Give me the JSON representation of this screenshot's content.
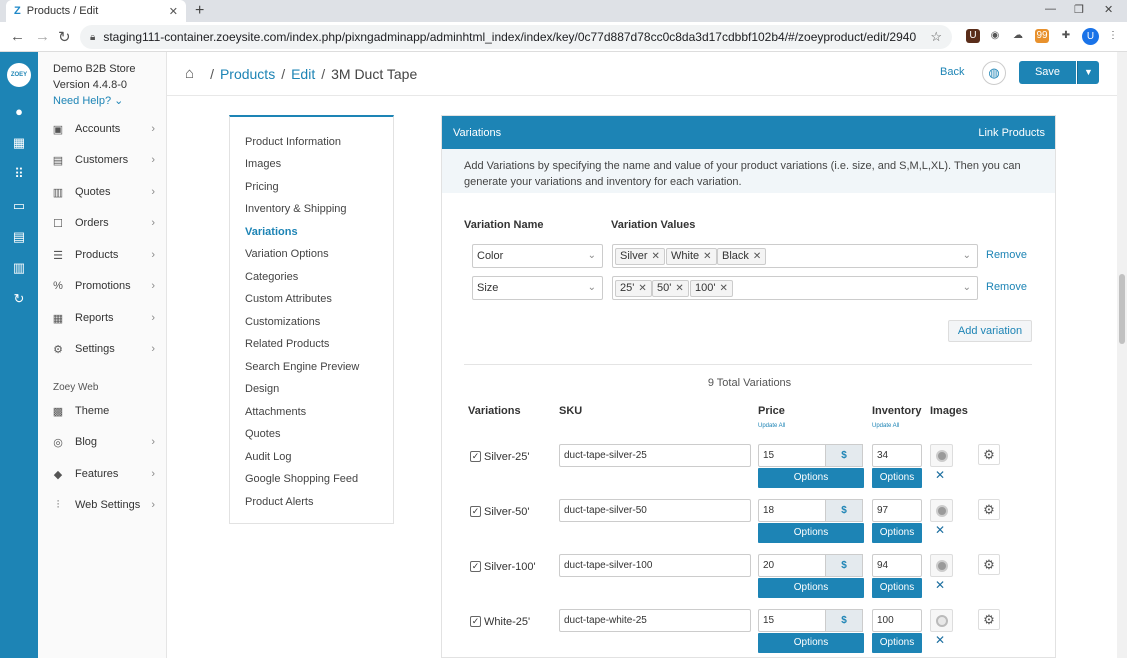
{
  "browser": {
    "tab_title": "Products / Edit",
    "tab_favicon": "Z",
    "url": "staging111-container.zoeysite.com/index.php/pixngadminapp/adminhtml_index/index/key/0c77d887d78cc0c8da3d17cdbbf102b4/#/zoeyproduct/edit/2940",
    "ext_badge": "99",
    "profile_initial": "U"
  },
  "rail": {
    "logo": "ZOEY"
  },
  "sidebar": {
    "store_name": "Demo B2B Store",
    "version": "Version 4.4.8-0",
    "help": "Need Help?",
    "items": [
      {
        "label": "Accounts",
        "icon": "▣"
      },
      {
        "label": "Customers",
        "icon": "▤"
      },
      {
        "label": "Quotes",
        "icon": "▥"
      },
      {
        "label": "Orders",
        "icon": "☐"
      },
      {
        "label": "Products",
        "icon": "☰"
      },
      {
        "label": "Promotions",
        "icon": "%"
      },
      {
        "label": "Reports",
        "icon": "▦"
      },
      {
        "label": "Settings",
        "icon": "⚙"
      }
    ],
    "section_label": "Zoey Web",
    "web_items": [
      {
        "label": "Theme",
        "icon": "▩"
      },
      {
        "label": "Blog",
        "icon": "◎"
      },
      {
        "label": "Features",
        "icon": "◆"
      },
      {
        "label": "Web Settings",
        "icon": "⫶"
      }
    ]
  },
  "header": {
    "crumb_products": "Products",
    "crumb_edit": "Edit",
    "crumb_current": "3M Duct Tape",
    "back_label": "Back",
    "save_label": "Save"
  },
  "section_menu": [
    "Product Information",
    "Images",
    "Pricing",
    "Inventory & Shipping",
    "Variations",
    "Variation Options",
    "Categories",
    "Custom Attributes",
    "Customizations",
    "Related Products",
    "Search Engine Preview",
    "Design",
    "Attachments",
    "Quotes",
    "Audit Log",
    "Google Shopping Feed",
    "Product Alerts"
  ],
  "section_menu_active": "Variations",
  "panel": {
    "title": "Variations",
    "link_products": "Link Products",
    "description": "Add Variations by specifying the name and value of your product variations (i.e. size, and S,M,L,XL). Then you can generate your variations and inventory for each variation.",
    "col_variation_name": "Variation Name",
    "col_variation_values": "Variation Values",
    "variation_rows": [
      {
        "name": "Color",
        "values": [
          "Silver",
          "White",
          "Black"
        ],
        "remove": "Remove"
      },
      {
        "name": "Size",
        "values": [
          "25'",
          "50'",
          "100'"
        ],
        "remove": "Remove"
      }
    ],
    "add_variation": "Add variation",
    "total_variations": "9 Total Variations",
    "table_headers": {
      "variations": "Variations",
      "sku": "SKU",
      "price": "Price",
      "inventory": "Inventory",
      "images": "Images",
      "update_all": "Update All"
    },
    "options_label": "Options",
    "currency_symbol": "$",
    "rows": [
      {
        "name": "Silver-25'",
        "sku": "duct-tape-silver-25",
        "price": "15",
        "inventory": "34",
        "image": "silver"
      },
      {
        "name": "Silver-50'",
        "sku": "duct-tape-silver-50",
        "price": "18",
        "inventory": "97",
        "image": "silver"
      },
      {
        "name": "Silver-100'",
        "sku": "duct-tape-silver-100",
        "price": "20",
        "inventory": "94",
        "image": "silver"
      },
      {
        "name": "White-25'",
        "sku": "duct-tape-white-25",
        "price": "15",
        "inventory": "100",
        "image": "white"
      }
    ]
  },
  "colors": {
    "brand": "#1d84b5"
  }
}
